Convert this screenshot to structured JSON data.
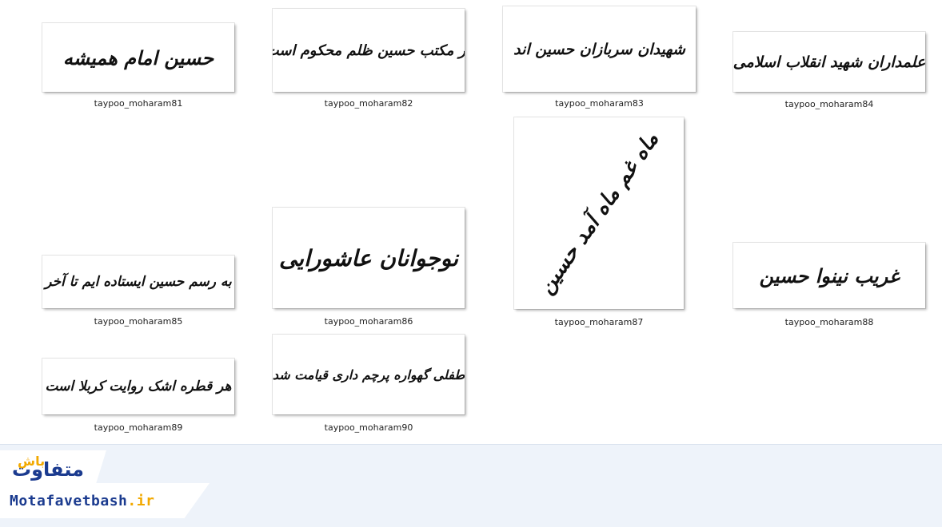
{
  "files": [
    {
      "name": "taypoo_moharam81",
      "calligraphy": "حسین امام همیشه"
    },
    {
      "name": "taypoo_moharam82",
      "calligraphy": "در مکتب حسین ظلم محکوم است"
    },
    {
      "name": "taypoo_moharam83",
      "calligraphy": "شهیدان سربازان حسین اند"
    },
    {
      "name": "taypoo_moharam84",
      "calligraphy": "علمداران شهید انقلاب اسلامی"
    },
    {
      "name": "taypoo_moharam85",
      "calligraphy": "به رسم حسین ایستاده ایم تا آخر"
    },
    {
      "name": "taypoo_moharam86",
      "calligraphy": "نوجوانان عاشورایی"
    },
    {
      "name": "taypoo_moharam87",
      "calligraphy": "ماه غم ماه آمد حسین"
    },
    {
      "name": "taypoo_moharam88",
      "calligraphy": "غریب نینوا حسین"
    },
    {
      "name": "taypoo_moharam89",
      "calligraphy": "هر قطره اشک روایت کربلا است"
    },
    {
      "name": "taypoo_moharam90",
      "calligraphy": "طفلی گهواره پرچم داری قیامت شد"
    }
  ],
  "watermark": {
    "logo_main": "متفاوت",
    "logo_accent": "باش",
    "url_part1": "Motafavet",
    "url_part2": "bash",
    "url_part3": ".ir"
  }
}
